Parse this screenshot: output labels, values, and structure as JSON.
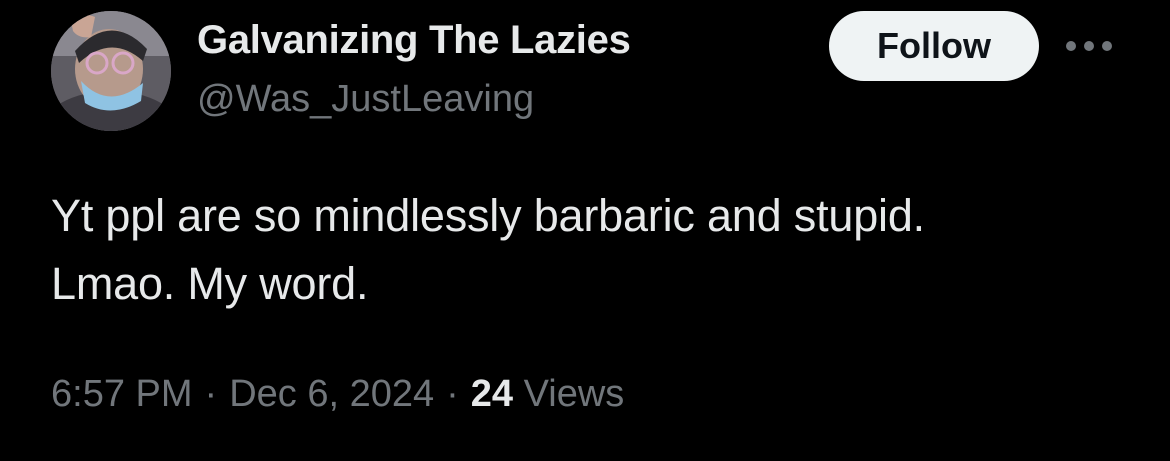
{
  "author": {
    "display_name": "Galvanizing The Lazies",
    "handle": "@Was_JustLeaving"
  },
  "actions": {
    "follow_label": "Follow",
    "more_icon": "more-horizontal-icon"
  },
  "tweet": {
    "lines": [
      "Yt ppl are so mindlessly barbaric and stupid.",
      "Lmao. My word."
    ]
  },
  "meta": {
    "time": "6:57 PM",
    "separator": "·",
    "date": "Dec 6, 2024",
    "views_count": "24",
    "views_label": "Views"
  },
  "colors": {
    "background": "#000000",
    "primary_text": "#e7e9ea",
    "secondary_text": "#71767b",
    "follow_bg": "#eff3f4",
    "follow_text": "#0f1419"
  }
}
